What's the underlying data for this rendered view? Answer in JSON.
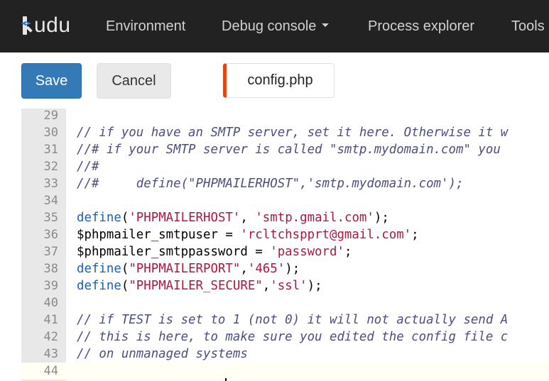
{
  "navbar": {
    "brand": "udu",
    "items": [
      {
        "label": "Environment"
      },
      {
        "label": "Debug console"
      },
      {
        "label": "Process explorer"
      },
      {
        "label": "Tools"
      }
    ]
  },
  "toolbar": {
    "save_label": "Save",
    "cancel_label": "Cancel",
    "file_tab": "config.php"
  },
  "colors": {
    "accent": "#337ab7",
    "file_tab_marker": "#e8430f",
    "comment": "#4a4f80",
    "function": "#1a5fb4",
    "string": "#b0163c"
  },
  "editor": {
    "lines": [
      {
        "n": "29",
        "tokens": []
      },
      {
        "n": "30",
        "tokens": [
          {
            "t": "comment",
            "v": "// if you have an SMTP server, set it here. Otherwise it w"
          }
        ]
      },
      {
        "n": "31",
        "tokens": [
          {
            "t": "comment",
            "v": "//# if your SMTP server is called \"smtp.mydomain.com\" you "
          }
        ]
      },
      {
        "n": "32",
        "tokens": [
          {
            "t": "comment",
            "v": "//#"
          }
        ]
      },
      {
        "n": "33",
        "tokens": [
          {
            "t": "comment",
            "v": "//#     define(\"PHPMAILERHOST\",'smtp.mydomain.com');"
          }
        ]
      },
      {
        "n": "34",
        "tokens": []
      },
      {
        "n": "35",
        "tokens": [
          {
            "t": "fn",
            "v": "define"
          },
          {
            "t": "plain",
            "v": "("
          },
          {
            "t": "str",
            "v": "'PHPMAILERHOST'"
          },
          {
            "t": "plain",
            "v": ", "
          },
          {
            "t": "str",
            "v": "'smtp.gmail.com'"
          },
          {
            "t": "plain",
            "v": ");"
          }
        ]
      },
      {
        "n": "36",
        "tokens": [
          {
            "t": "plain",
            "v": "$phpmailer_smtpuser = "
          },
          {
            "t": "str",
            "v": "'rcltchspprt@gmail.com'"
          },
          {
            "t": "plain",
            "v": ";"
          }
        ]
      },
      {
        "n": "37",
        "tokens": [
          {
            "t": "plain",
            "v": "$phpmailer_smtppassword = "
          },
          {
            "t": "str",
            "v": "'password'"
          },
          {
            "t": "plain",
            "v": ";"
          }
        ]
      },
      {
        "n": "38",
        "tokens": [
          {
            "t": "fn",
            "v": "define"
          },
          {
            "t": "plain",
            "v": "("
          },
          {
            "t": "str",
            "v": "\"PHPMAILERPORT\""
          },
          {
            "t": "plain",
            "v": ","
          },
          {
            "t": "str",
            "v": "'465'"
          },
          {
            "t": "plain",
            "v": ");"
          }
        ]
      },
      {
        "n": "39",
        "tokens": [
          {
            "t": "fn",
            "v": "define"
          },
          {
            "t": "plain",
            "v": "("
          },
          {
            "t": "str",
            "v": "\"PHPMAILER_SECURE\""
          },
          {
            "t": "plain",
            "v": ","
          },
          {
            "t": "str",
            "v": "'ssl'"
          },
          {
            "t": "plain",
            "v": ");"
          }
        ]
      },
      {
        "n": "40",
        "tokens": []
      },
      {
        "n": "41",
        "tokens": [
          {
            "t": "comment",
            "v": "// if TEST is set to 1 (not 0) it will not actually send A"
          }
        ]
      },
      {
        "n": "42",
        "tokens": [
          {
            "t": "comment",
            "v": "// this is here, to make sure you edited the config file c"
          }
        ]
      },
      {
        "n": "43",
        "tokens": [
          {
            "t": "comment",
            "v": "// on unmanaged systems"
          }
        ]
      },
      {
        "n": "44",
        "tokens": []
      }
    ]
  }
}
